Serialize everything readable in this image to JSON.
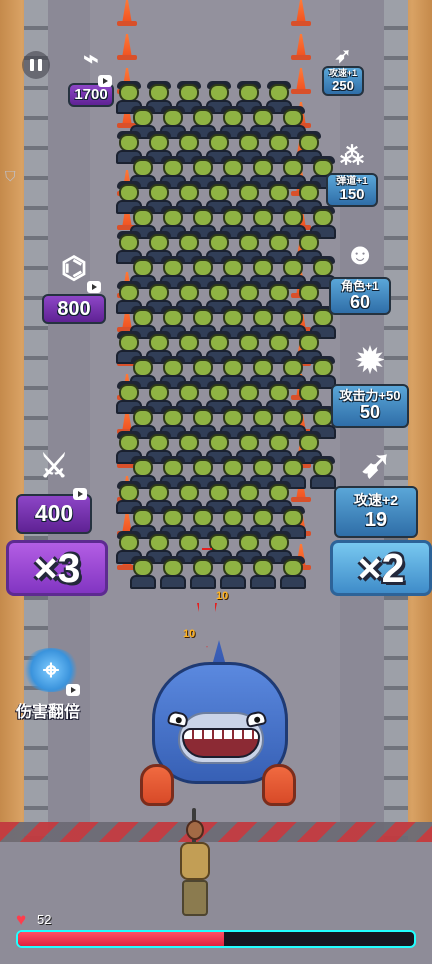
{
  "game": {
    "hp": {
      "label": "52",
      "fill_fraction": 0.52,
      "color": "#df233e",
      "border_color": "#22ffff"
    },
    "left_rewards": [
      {
        "id": "weapon-upgrade-1700",
        "value": "1700",
        "icon": "weapon-rack-icon",
        "color": "#5f2294"
      },
      {
        "id": "weapon-upgrade-800",
        "value": "800",
        "icon": "blaster-icon",
        "color": "#5f2294"
      },
      {
        "id": "weapon-upgrade-400",
        "value": "400",
        "icon": "knife-icon",
        "color": "#5f2294"
      }
    ],
    "right_rewards": [
      {
        "id": "attack-speed-1",
        "label": "攻速+1",
        "value": "250",
        "icon": "bullet-icon",
        "color": "#2f6ea8"
      },
      {
        "id": "ballistic-1",
        "label": "弹道+1",
        "value": "150",
        "icon": "multiple-bullets-icon",
        "color": "#2f6ea8"
      },
      {
        "id": "character-1",
        "label": "角色+1",
        "value": "60",
        "icon": "character-portrait-icon",
        "color": "#2f6ea8"
      },
      {
        "id": "attack-power-50",
        "label": "攻击力+50",
        "value": "50",
        "icon": "explosive-bullet-icon",
        "color": "#2f6ea8"
      },
      {
        "id": "attack-speed-2",
        "label": "攻速+2",
        "value": "19",
        "icon": "speed-bullet-icon",
        "color": "#2f6ea8"
      }
    ],
    "gates": [
      {
        "side": "left",
        "label": "×3",
        "color": "#8235c2"
      },
      {
        "side": "right",
        "label": "×2",
        "color": "#3f8cc9"
      }
    ],
    "damage_boost": {
      "label": "伤害翻倍",
      "icon": "damage-pistol-icon"
    },
    "hit_numbers": [
      "10",
      "10"
    ]
  }
}
